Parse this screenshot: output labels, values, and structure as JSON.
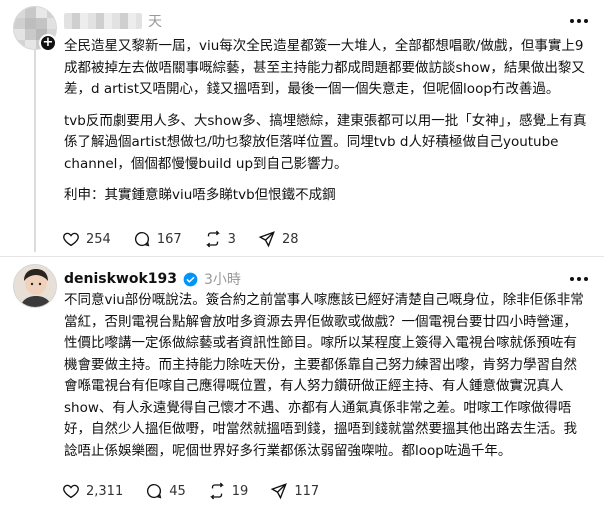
{
  "post1": {
    "username": "",
    "time": "天",
    "paragraphs": [
      "全民造星又黎新一屆，viu每次全民造星都簽一大堆人，全部都想唱歌/做戲，但事實上9成都被掉左去做唔關事嘅綜藝，甚至主持能力都成問題都要做訪談show，結果做出黎又差，d artist又唔開心，錢又搵唔到，最後一個一個失意走，但呢個loop冇改善過。",
      "tvb反而劇要用人多、大show多、搞埋戀綜，建東張都可以用一批「女神」，感覺上有真係了解過個artist想做乜/叻乜黎放佢落咩位置。同埋tvb d人好積極做自己youtube channel，個個都慢慢build up到自己影響力。",
      "利申：其實鍾意睇viu唔多睇tvb但恨鐵不成鋼"
    ],
    "likes": "254",
    "replies": "167",
    "reposts": "3",
    "shares": "28"
  },
  "post2": {
    "username": "deniskwok193",
    "time": "3小時",
    "paragraphs": [
      "不同意viu部份嘅說法。簽合約之前當事人𠺢應該已經好清楚自己嘅身位，除非佢係非常當紅，否則電視台點解會放咁多資源去畀佢做歌或做戲？一個電視台要廿四小時營運，性價比嚟講一定係做綜藝或者資訊性節目。𠺢所以某程度上簽得入電視台𠺢就係預咗有機會要做主持。而主持能力除咗天份，主要都係靠自己努力練習出嚟，肯努力學習自然會喺電視台有佢𠺢自己應得嘅位置，有人努力鑽研做正經主持、有人鍾意做實況真人show、有人永遠覺得自己懷才不遇、亦都有人通氣真係非常之差。咁𠺢工作𠺢做得唔好，自然少人搵佢做嘢，咁當然就搵唔到錢，搵唔到錢就當然要搵其他出路去生活。我諗唔止係娛樂圈，呢個世界好多行業都係汰弱留強㗎啦。都loop咗過千年。"
    ],
    "likes": "2,311",
    "replies": "45",
    "reposts": "19",
    "shares": "117"
  },
  "icons": {
    "like": "heart-icon",
    "reply": "comment-icon",
    "repost": "repost-icon",
    "share": "share-icon",
    "more": "more-icon",
    "verified": "verified-badge-icon",
    "follow": "plus-icon"
  },
  "colors": {
    "text": "#111111",
    "muted": "#999999",
    "verified": "#0095f6",
    "divider": "#e5e5e5"
  }
}
